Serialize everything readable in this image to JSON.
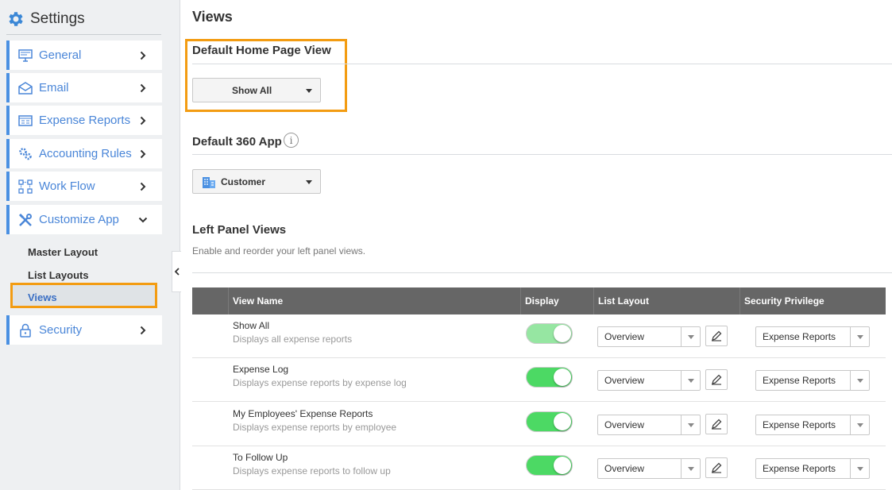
{
  "sidebar": {
    "title": "Settings",
    "items": [
      {
        "label": "General",
        "icon": "monitor-icon"
      },
      {
        "label": "Email",
        "icon": "envelope-icon"
      },
      {
        "label": "Expense Reports",
        "icon": "report-icon"
      },
      {
        "label": "Accounting Rules",
        "icon": "gears-icon"
      },
      {
        "label": "Work Flow",
        "icon": "workflow-icon"
      },
      {
        "label": "Customize App",
        "icon": "tools-icon",
        "expanded": true
      },
      {
        "label": "Security",
        "icon": "lock-icon"
      }
    ],
    "subitems": [
      "Master Layout",
      "List Layouts",
      "Views"
    ],
    "selected_subitem": "Views"
  },
  "main": {
    "title": "Views",
    "default_home": {
      "title": "Default Home Page View",
      "value": "Show All"
    },
    "default_360": {
      "title": "Default 360 App",
      "value": "Customer",
      "info_glyph": "i"
    },
    "left_panel": {
      "title": "Left Panel Views",
      "subtitle": "Enable and reorder your left panel views."
    }
  },
  "table": {
    "headers": {
      "view_name": "View Name",
      "display": "Display",
      "list_layout": "List Layout",
      "security": "Security Privilege"
    },
    "rows": [
      {
        "name": "Show All",
        "desc": "Displays all expense reports",
        "display": true,
        "display_locked": true,
        "list_layout": "Overview",
        "security": "Expense Reports"
      },
      {
        "name": "Expense Log",
        "desc": "Displays expense reports by expense log",
        "display": true,
        "list_layout": "Overview",
        "security": "Expense Reports"
      },
      {
        "name": "My Employees' Expense Reports",
        "desc": "Displays expense reports by employee",
        "display": true,
        "list_layout": "Overview",
        "security": "Expense Reports"
      },
      {
        "name": "To Follow Up",
        "desc": "Displays expense reports to follow up",
        "display": true,
        "list_layout": "Overview",
        "security": "Expense Reports"
      }
    ]
  },
  "colors": {
    "accent": "#4a90e2",
    "highlight": "#f39c12",
    "toggle_on": "#4cd964",
    "header_bg": "#666666"
  }
}
